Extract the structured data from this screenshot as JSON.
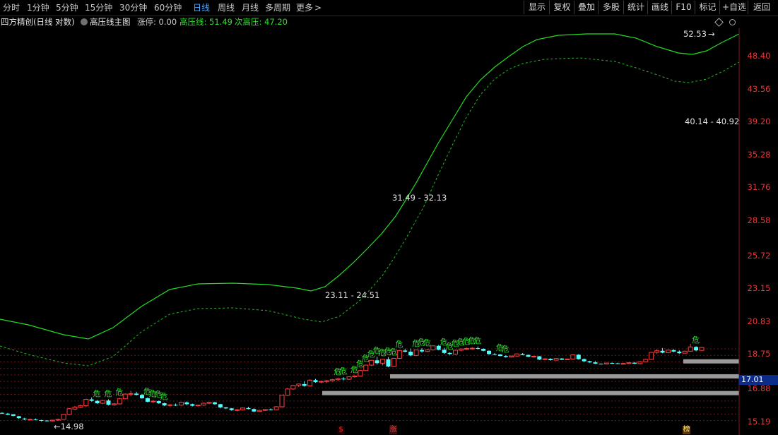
{
  "toolbar": {
    "periods": [
      "分时",
      "1分钟",
      "5分钟",
      "15分钟",
      "30分钟",
      "60分钟",
      "日线",
      "周线",
      "月线",
      "多周期",
      "更多"
    ],
    "active_period": "日线",
    "tools": [
      "显示",
      "复权",
      "叠加",
      "多股",
      "统计",
      "画线",
      "F10",
      "标记",
      "+自选",
      "返回"
    ],
    "more_arrow": ">"
  },
  "legend": {
    "stock_name": "四方精创(日线 对数)",
    "indicator_name": "高压线主图",
    "limit_label": "涨停: 0.00",
    "high_line_label": "高压线: 51.49",
    "sub_high_label": "次高压: 47.20"
  },
  "y_axis": {
    "ticks": [
      "48.40",
      "43.56",
      "39.20",
      "35.28",
      "31.76",
      "28.58",
      "25.72",
      "23.15",
      "20.83",
      "18.75",
      "16.88",
      "15.19"
    ],
    "current_price": "17.01"
  },
  "annotations": {
    "zone_labels": [
      "23.11 - 24.51",
      "31.49 - 32.13",
      "40.14 - 40.92"
    ],
    "low_marker": "14.98",
    "high_marker": "52.53",
    "danger_label": "危",
    "bottom_marks": [
      "$",
      "涨",
      "榜"
    ]
  },
  "colors": {
    "up": "#ff4040",
    "down": "#54ffff",
    "high_line": "#22dd22",
    "sub_line": "#22bb22",
    "zone": "#9a9a9a",
    "grid": "#6a1a1a",
    "active": "#4aa8ff"
  }
}
